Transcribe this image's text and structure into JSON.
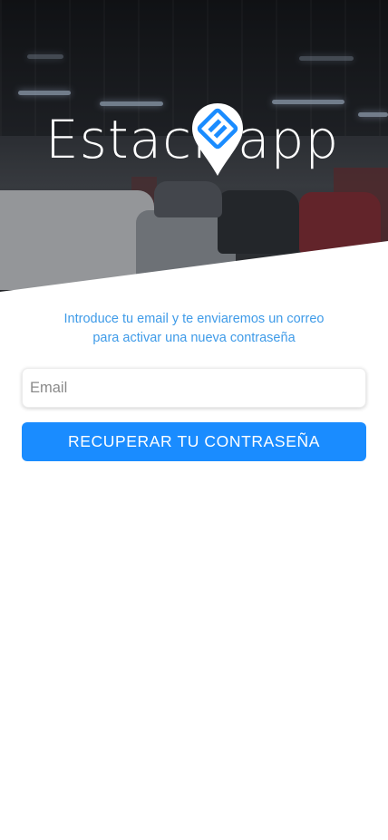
{
  "hero": {
    "logo_left": "Estaci",
    "logo_right": "app",
    "logo_icon": "location-pin-e-icon"
  },
  "recover": {
    "instructions_line1": "Introduce tu email y te enviaremos un correo",
    "instructions_line2": "para activar una nueva contraseña",
    "email_placeholder": "Email",
    "email_value": "",
    "submit_label": "RECUPERAR TU CONTRASEÑA"
  },
  "colors": {
    "primary": "#1a8cff",
    "instruction_text": "#3f9be8",
    "background": "#ffffff"
  }
}
